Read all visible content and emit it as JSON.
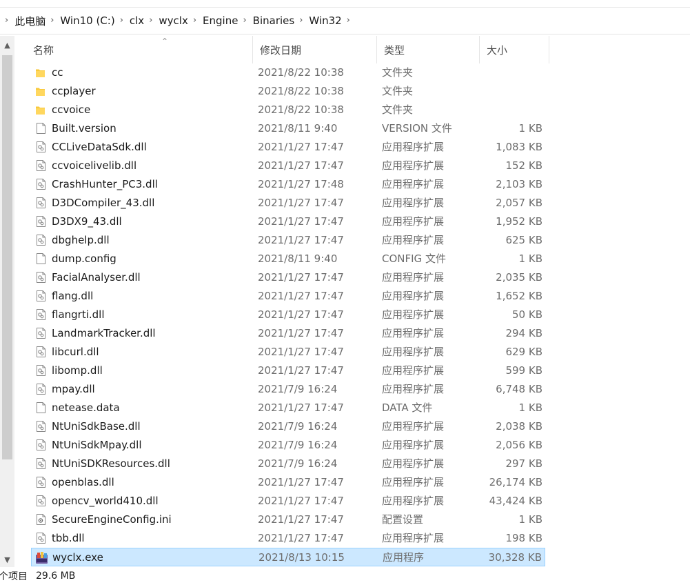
{
  "breadcrumb": [
    "此电脑",
    "Win10 (C:)",
    "clx",
    "wyclx",
    "Engine",
    "Binaries",
    "Win32"
  ],
  "columns": {
    "name": "名称",
    "date": "修改日期",
    "type": "类型",
    "size": "大小"
  },
  "files": [
    {
      "name": "cc",
      "date": "2021/8/22 10:38",
      "type": "文件夹",
      "size": "",
      "icon": "folder-icon"
    },
    {
      "name": "ccplayer",
      "date": "2021/8/22 10:38",
      "type": "文件夹",
      "size": "",
      "icon": "folder-icon"
    },
    {
      "name": "ccvoice",
      "date": "2021/8/22 10:38",
      "type": "文件夹",
      "size": "",
      "icon": "folder-icon"
    },
    {
      "name": "Built.version",
      "date": "2021/8/11 9:40",
      "type": "VERSION 文件",
      "size": "1 KB",
      "icon": "file-icon"
    },
    {
      "name": "CCLiveDataSdk.dll",
      "date": "2021/1/27 17:47",
      "type": "应用程序扩展",
      "size": "1,083 KB",
      "icon": "dll-icon"
    },
    {
      "name": "ccvoicelivelib.dll",
      "date": "2021/1/27 17:47",
      "type": "应用程序扩展",
      "size": "152 KB",
      "icon": "dll-icon"
    },
    {
      "name": "CrashHunter_PC3.dll",
      "date": "2021/1/27 17:48",
      "type": "应用程序扩展",
      "size": "2,103 KB",
      "icon": "dll-icon"
    },
    {
      "name": "D3DCompiler_43.dll",
      "date": "2021/1/27 17:47",
      "type": "应用程序扩展",
      "size": "2,057 KB",
      "icon": "dll-icon"
    },
    {
      "name": "D3DX9_43.dll",
      "date": "2021/1/27 17:47",
      "type": "应用程序扩展",
      "size": "1,952 KB",
      "icon": "dll-icon"
    },
    {
      "name": "dbghelp.dll",
      "date": "2021/1/27 17:47",
      "type": "应用程序扩展",
      "size": "625 KB",
      "icon": "dll-icon"
    },
    {
      "name": "dump.config",
      "date": "2021/8/11 9:40",
      "type": "CONFIG 文件",
      "size": "1 KB",
      "icon": "file-icon"
    },
    {
      "name": "FacialAnalyser.dll",
      "date": "2021/1/27 17:47",
      "type": "应用程序扩展",
      "size": "2,035 KB",
      "icon": "dll-icon"
    },
    {
      "name": "flang.dll",
      "date": "2021/1/27 17:47",
      "type": "应用程序扩展",
      "size": "1,652 KB",
      "icon": "dll-icon"
    },
    {
      "name": "flangrti.dll",
      "date": "2021/1/27 17:47",
      "type": "应用程序扩展",
      "size": "50 KB",
      "icon": "dll-icon"
    },
    {
      "name": "LandmarkTracker.dll",
      "date": "2021/1/27 17:47",
      "type": "应用程序扩展",
      "size": "294 KB",
      "icon": "dll-icon"
    },
    {
      "name": "libcurl.dll",
      "date": "2021/1/27 17:47",
      "type": "应用程序扩展",
      "size": "629 KB",
      "icon": "dll-icon"
    },
    {
      "name": "libomp.dll",
      "date": "2021/1/27 17:47",
      "type": "应用程序扩展",
      "size": "599 KB",
      "icon": "dll-icon"
    },
    {
      "name": "mpay.dll",
      "date": "2021/7/9 16:24",
      "type": "应用程序扩展",
      "size": "6,748 KB",
      "icon": "dll-icon"
    },
    {
      "name": "netease.data",
      "date": "2021/1/27 17:47",
      "type": "DATA 文件",
      "size": "1 KB",
      "icon": "file-icon"
    },
    {
      "name": "NtUniSdkBase.dll",
      "date": "2021/7/9 16:24",
      "type": "应用程序扩展",
      "size": "2,038 KB",
      "icon": "dll-icon"
    },
    {
      "name": "NtUniSdkMpay.dll",
      "date": "2021/7/9 16:24",
      "type": "应用程序扩展",
      "size": "2,056 KB",
      "icon": "dll-icon"
    },
    {
      "name": "NtUniSDKResources.dll",
      "date": "2021/7/9 16:24",
      "type": "应用程序扩展",
      "size": "297 KB",
      "icon": "dll-icon"
    },
    {
      "name": "openblas.dll",
      "date": "2021/1/27 17:47",
      "type": "应用程序扩展",
      "size": "26,174 KB",
      "icon": "dll-icon"
    },
    {
      "name": "opencv_world410.dll",
      "date": "2021/1/27 17:47",
      "type": "应用程序扩展",
      "size": "43,424 KB",
      "icon": "dll-icon"
    },
    {
      "name": "SecureEngineConfig.ini",
      "date": "2021/1/27 17:47",
      "type": "配置设置",
      "size": "1 KB",
      "icon": "ini-icon"
    },
    {
      "name": "tbb.dll",
      "date": "2021/1/27 17:47",
      "type": "应用程序扩展",
      "size": "198 KB",
      "icon": "dll-icon"
    },
    {
      "name": "wyclx.exe",
      "date": "2021/8/13 10:15",
      "type": "应用程序",
      "size": "30,328 KB",
      "icon": "exe-icon",
      "selected": true
    }
  ],
  "status": {
    "count": "个项目",
    "size": "29.6 MB"
  },
  "colors": {
    "selection_bg": "#cce8ff",
    "selection_border": "#99d1ff",
    "folder": "#f8c93b"
  }
}
